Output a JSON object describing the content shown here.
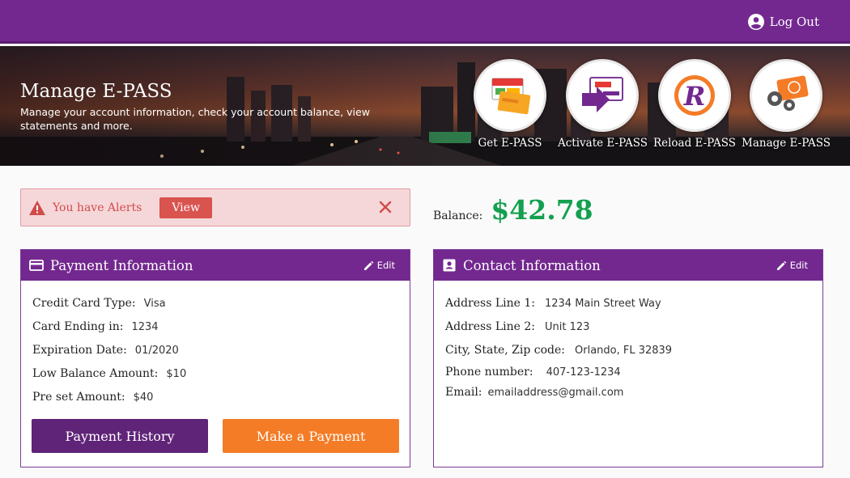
{
  "header": {
    "logout_label": "Log Out"
  },
  "hero": {
    "title": "Manage E-PASS",
    "subtitle": "Manage your account information, check your account balance, view statements and more.",
    "quick_links": [
      {
        "label": "Get E-PASS",
        "icon": "get-epass-cards-icon"
      },
      {
        "label": "Activate E-PASS",
        "icon": "activate-epass-arrow-icon"
      },
      {
        "label": "Reload E-PASS",
        "icon": "reload-r-icon"
      },
      {
        "label": "Manage E-PASS",
        "icon": "manage-gears-card-icon"
      }
    ]
  },
  "alert": {
    "text": "You have Alerts",
    "view_label": "View"
  },
  "balance": {
    "label": "Balance:",
    "amount": "$42.78"
  },
  "payment": {
    "title": "Payment Information",
    "edit_label": "Edit",
    "rows": [
      {
        "label": "Credit Card Type:",
        "value": "Visa"
      },
      {
        "label": "Card Ending in:",
        "value": "1234"
      },
      {
        "label": "Expiration Date:",
        "value": "01/2020"
      },
      {
        "label": "Low Balance Amount:",
        "value": "$10"
      },
      {
        "label": "Pre set Amount:",
        "value": "$40"
      }
    ],
    "history_button": "Payment History",
    "pay_button": "Make a Payment"
  },
  "contact": {
    "title": "Contact Information",
    "edit_label": "Edit",
    "rows": [
      {
        "label": "Address Line 1:",
        "value": "1234 Main Street Way"
      },
      {
        "label": "Address Line 2:",
        "value": "Unit 123"
      },
      {
        "label": "City, State, Zip code:",
        "value": "Orlando, FL 32839"
      },
      {
        "label": "Phone number:",
        "value": "407-123-1234"
      },
      {
        "label": "Email:",
        "value": "emailaddress@gmail.com"
      }
    ]
  },
  "colors": {
    "brand_purple": "#73288f",
    "accent_orange": "#f47c27",
    "balance_green": "#13a04f",
    "alert_red": "#d9534f"
  }
}
